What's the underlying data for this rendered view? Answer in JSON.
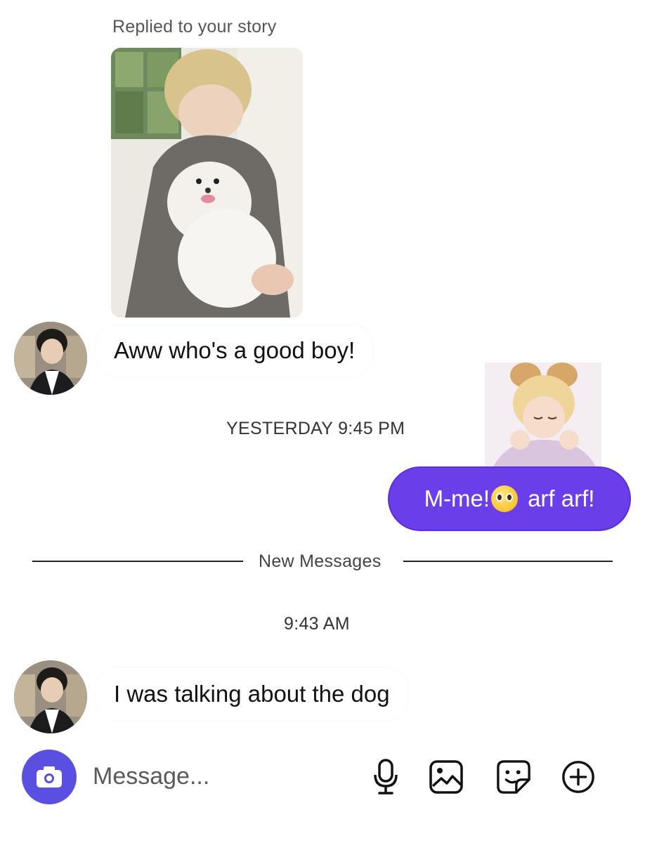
{
  "story_reply": {
    "label": "Replied to your story"
  },
  "messages": [
    {
      "direction": "incoming",
      "text": "Aww who's a good boy!"
    },
    {
      "direction": "outgoing",
      "text_before_emoji": "M-me!",
      "emoji": "pleading-face-emoji",
      "text_after_emoji": "arf arf!"
    },
    {
      "direction": "incoming",
      "text": "I was talking about the dog"
    }
  ],
  "timestamps": {
    "first": "YESTERDAY 9:45 PM",
    "second": "9:43 AM"
  },
  "divider": {
    "label": "New Messages"
  },
  "composer": {
    "placeholder": "Message...",
    "icons": [
      "camera-icon",
      "microphone-icon",
      "gallery-icon",
      "sticker-icon",
      "add-icon"
    ]
  },
  "colors": {
    "outgoing_bubble": "#6a3ee8",
    "camera_button": "#5a4fe0"
  }
}
